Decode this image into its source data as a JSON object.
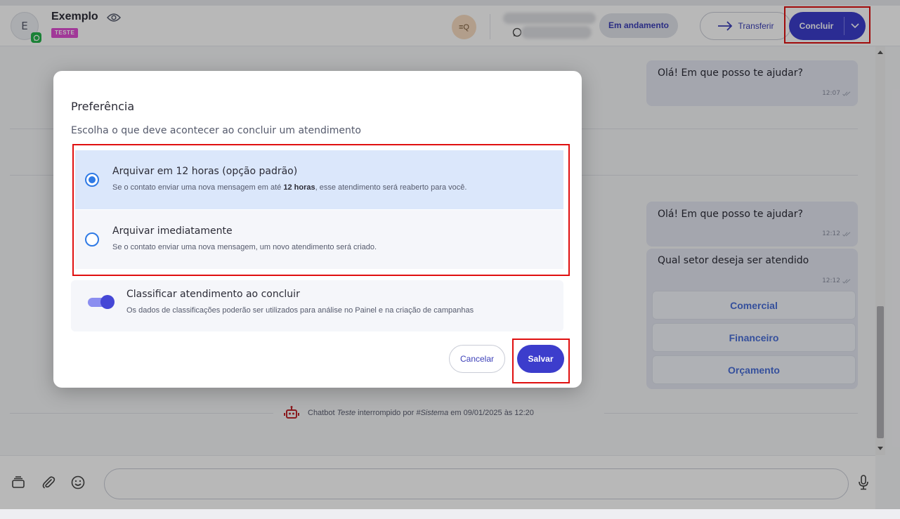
{
  "header": {
    "avatar_initial": "E",
    "contact_name": "Exemplo",
    "tag": "TESTE",
    "search_chip_label": "≡Q",
    "status": "Em andamento",
    "transfer_label": "Transferir",
    "conclude_label": "Concluir"
  },
  "chat": {
    "messages": [
      {
        "text": "Olá! Em que posso te ajudar?",
        "time": "12:07"
      },
      {
        "text": "Olá! Em que posso te ajudar?",
        "time": "12:12"
      },
      {
        "text": "Qual setor deseja ser atendido",
        "time": "12:12"
      }
    ],
    "options": [
      "Comercial",
      "Financeiro",
      "Orçamento"
    ],
    "system_message": {
      "prefix": "Chatbot ",
      "bot_name": "Teste",
      "middle": " interrompido por ",
      "actor": "#Sistema",
      "suffix": " em 09/01/2025 às 12:20"
    }
  },
  "modal": {
    "title": "Preferência",
    "subtitle": "Escolha o que deve acontecer ao concluir um atendimento",
    "options": [
      {
        "title": "Arquivar em 12 horas (opção padrão)",
        "desc_before": "Se o contato enviar uma nova mensagem em até ",
        "desc_bold": "12 horas",
        "desc_after": ", esse atendimento será reaberto para você.",
        "selected": true
      },
      {
        "title": "Arquivar imediatamente",
        "desc": "Se o contato enviar uma nova mensagem, um novo atendimento será criado.",
        "selected": false
      }
    ],
    "classify": {
      "title": "Classificar atendimento ao concluir",
      "desc": "Os dados de classificações poderão ser utilizados para análise no Painel e na criação de campanhas",
      "enabled": true
    },
    "cancel_label": "Cancelar",
    "save_label": "Salvar"
  },
  "colors": {
    "accent": "#3c3dcc",
    "highlight": "#e01010",
    "whatsapp": "#25b34b",
    "tag": "#e04fd3"
  }
}
